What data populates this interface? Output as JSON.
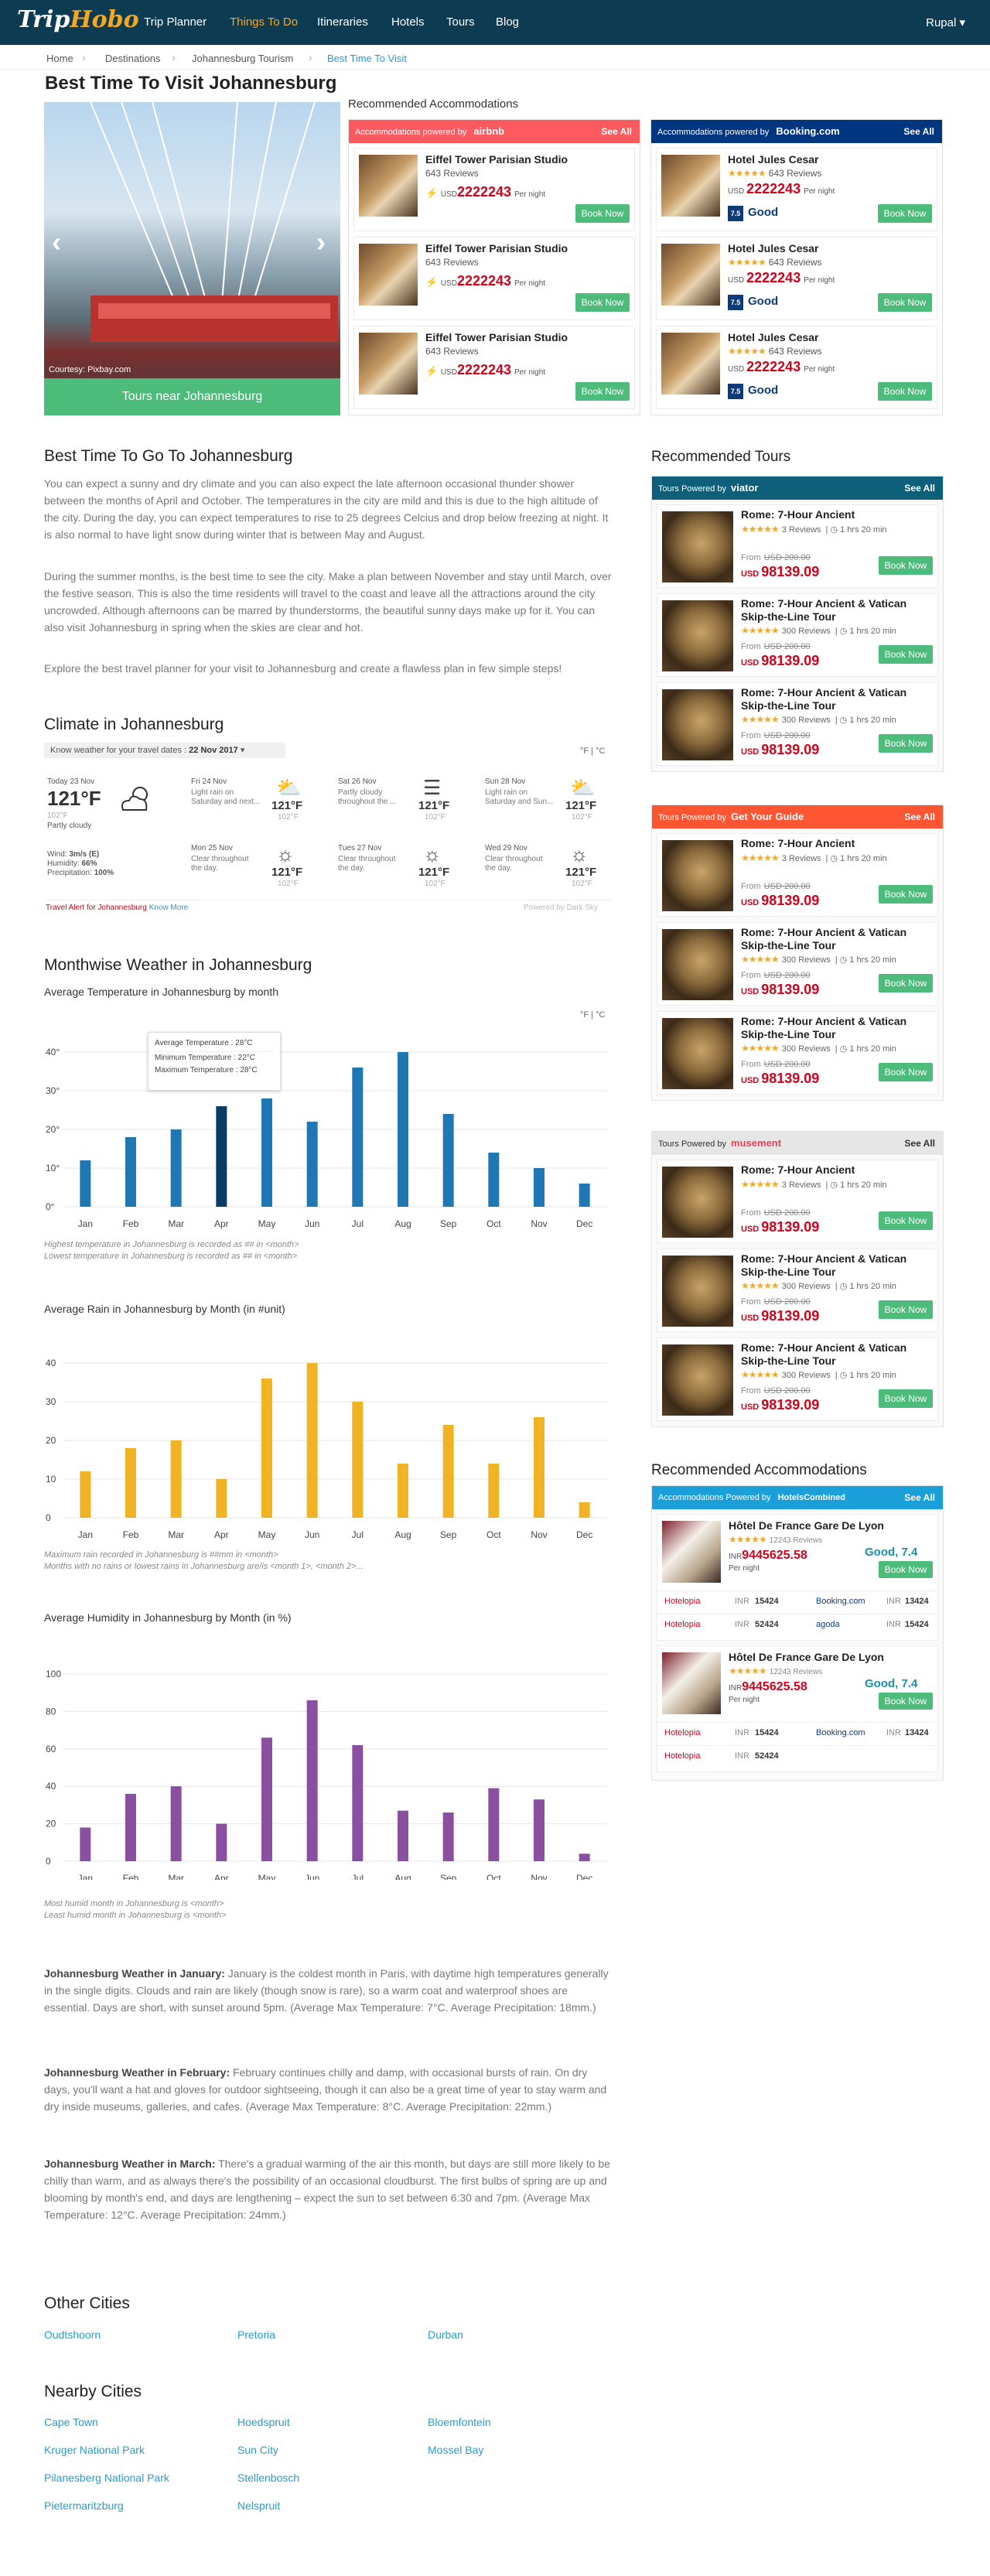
{
  "header": {
    "logo_main": "Trip",
    "logo_accent": "Hobo",
    "nav": [
      "Trip Planner",
      "Things To Do",
      "Itineraries",
      "Hotels",
      "Tours",
      "Blog"
    ],
    "user": "Rupal ▾",
    "colors": {
      "bg": "#0d3b52",
      "active": "#f5a623"
    }
  },
  "breadcrumb": [
    "Home",
    "Destinations",
    "Johannesburg Tourism",
    "Best Time To Visit"
  ],
  "page_title": "Best Time To Visit Johannesburg",
  "slider": {
    "credit": "Courtesy: Pixbay.com",
    "cta": "Tours near Johannesburg",
    "prev_icon": "chevron-left-icon",
    "next_icon": "chevron-right-icon"
  },
  "recommended_accommodations_title": "Recommended Accommodations",
  "airbnb": {
    "head": "Accommodations powered by",
    "brand": "airbnb",
    "see_all": "See All",
    "color": "#ff5a5f",
    "items": [
      {
        "name": "Eiffel Tower Parisian Studio",
        "reviews": "643 Reviews",
        "currency": "USD",
        "price": "2222243",
        "per": "Per night",
        "cta": "Book Now"
      },
      {
        "name": "Eiffel Tower Parisian Studio",
        "reviews": "643 Reviews",
        "currency": "USD",
        "price": "2222243",
        "per": "Per night",
        "cta": "Book Now"
      },
      {
        "name": "Eiffel Tower Parisian Studio",
        "reviews": "643 Reviews",
        "currency": "USD",
        "price": "2222243",
        "per": "Per night",
        "cta": "Book Now"
      }
    ]
  },
  "booking": {
    "head": "Accommodations powered by",
    "brand": "Booking.com",
    "see_all": "See All",
    "color": "#003580",
    "items": [
      {
        "name": "Hotel Jules Cesar",
        "stars": "★★★★★",
        "reviews": "643 Reviews",
        "currency": "USD",
        "price": "2222243",
        "per": "Per night",
        "score": "7.5",
        "score_label": "Good",
        "cta": "Book Now"
      },
      {
        "name": "Hotel Jules Cesar",
        "stars": "★★★★★",
        "reviews": "643 Reviews",
        "currency": "USD",
        "price": "2222243",
        "per": "Per night",
        "score": "7.5",
        "score_label": "Good",
        "cta": "Book Now"
      },
      {
        "name": "Hotel Jules Cesar",
        "stars": "★★★★★",
        "reviews": "643 Reviews",
        "currency": "USD",
        "price": "2222243",
        "per": "Per night",
        "score": "7.5",
        "score_label": "Good",
        "cta": "Book Now"
      }
    ]
  },
  "best_time": {
    "title": "Best Time To Go To Johannesburg",
    "p1": "You can expect a sunny and dry climate and you can also expect the late afternoon occasional thunder shower between the months of April and October. The temperatures in the city are mild and this is due to the high altitude of the city. During the day, you can expect temperatures to rise to 25 degrees Celcius and drop below freezing at night. It is also normal to have light snow during winter that is between May and August.",
    "p2": "During the summer months, is the best time to see the city. Make a plan between November and stay until March, over the festive season. This is also the time residents will travel to the coast and leave all the attractions around the city uncrowded. Although afternoons can be marred by thunderstorms, the beautiful sunny days make up for it. You can also visit Johannesburg in spring when the skies are clear and hot.",
    "p3": "Explore the best travel planner for your visit to Johannesburg and create a flawless plan in few simple steps!"
  },
  "climate": {
    "title": "Climate in Johannesburg",
    "know_label": "Know  weather for your travel dates :",
    "date_value": "22 Nov 2017",
    "units": "°F | °C",
    "today": {
      "day": "Today 23 Nov",
      "temp": "121°F",
      "low": "102°F",
      "desc": "Partly cloudy",
      "wind_label": "Wind:",
      "wind": "3m/s (E)",
      "hum_label": "Humidity:",
      "hum": "66%",
      "prec_label": "Precipitation:",
      "prec": "100%"
    },
    "forecast": [
      {
        "day": "Fri 24 Nov",
        "desc": "Light rain on Saturday and next...",
        "temp": "121°F",
        "low": "102°F",
        "icon": "partly-cloudy-icon"
      },
      {
        "day": "Sat 26 Nov",
        "desc": "Partly cloudy throughout the ...",
        "temp": "121°F",
        "low": "102°F",
        "icon": "fog-icon"
      },
      {
        "day": "Sun 28 Nov",
        "desc": "Light rain on Saturday and Sun...",
        "temp": "121°F",
        "low": "102°F",
        "icon": "partly-cloudy-icon"
      },
      {
        "day": "Mon 25 Nov",
        "desc": "Clear throughout the day.",
        "temp": "121°F",
        "low": "102°F",
        "icon": "sun-icon"
      },
      {
        "day": "Tues 27 Nov",
        "desc": "Clear throughout the day.",
        "temp": "121°F",
        "low": "102°F",
        "icon": "sun-icon"
      },
      {
        "day": "Wed 29 Nov",
        "desc": "Clear throughout the day.",
        "temp": "121°F",
        "low": "102°F",
        "icon": "sun-icon"
      }
    ],
    "alert_label": "Travel Alert for Johannesburg",
    "alert_link": "Know More",
    "powered": "Powered by Dark Sky"
  },
  "monthwise": {
    "title": "Monthwise Weather in Johannesburg",
    "temp_sub": "Average Temperature in Johannesburg by month",
    "temp_units": "°F | °C",
    "temp_note1": "Highest temperature in Johannesburg is recorded as ## in <month>",
    "temp_note2": "Lowest temperature in Johannesburg is recorded as ## in <month>",
    "tooltip": {
      "avg": "Average Temperature : 28°C",
      "min": "Minimum Temperature : 22°C",
      "max": "Maximum Temperature : 28°C"
    },
    "rain_sub": "Average Rain in Johannesburg by Month (in #unit)",
    "rain_note1": "Maximum rain recorded in Johannesburg is ##mm in <month>",
    "rain_note2": "Months with no rains or lowest rains in Johannesburg are/is <month 1>, <month 2>...",
    "hum_sub": "Average Humidity in Johannesburg by Month (in %)",
    "hum_note1": "Most humid month in Johannesburg is <month>",
    "hum_note2": "Least humid month in Johannesburg is <month>"
  },
  "chart_data": [
    {
      "type": "bar",
      "title": "Average Temperature in Johannesburg by month",
      "categories": [
        "Jan",
        "Feb",
        "Mar",
        "Apr",
        "May",
        "Jun",
        "Jul",
        "Aug",
        "Sep",
        "Oct",
        "Nov",
        "Dec"
      ],
      "values": [
        12,
        18,
        20,
        26,
        28,
        22,
        36,
        40,
        24,
        14,
        10,
        6
      ],
      "y_ticks": [
        "0°",
        "10°",
        "20°",
        "30°",
        "40°"
      ],
      "ylim": [
        0,
        40
      ],
      "color": "#1f77b4",
      "highlight_color": "#0b3b63",
      "highlight_index": 3
    },
    {
      "type": "bar",
      "title": "Average Rain in Johannesburg by Month (in #unit)",
      "categories": [
        "Jan",
        "Feb",
        "Mar",
        "Apr",
        "May",
        "Jun",
        "Jul",
        "Aug",
        "Sep",
        "Oct",
        "Nov",
        "Dec"
      ],
      "values": [
        12,
        18,
        20,
        10,
        36,
        40,
        30,
        14,
        24,
        14,
        26,
        4
      ],
      "y_ticks": [
        "0",
        "10",
        "20",
        "30",
        "40"
      ],
      "ylim": [
        0,
        40
      ],
      "color": "#f0b323"
    },
    {
      "type": "bar",
      "title": "Average Humidity in Johannesburg by Month (in %)",
      "categories": [
        "Jan",
        "Feb",
        "Mar",
        "Apr",
        "May",
        "Jun",
        "Jul",
        "Aug",
        "Sep",
        "Oct",
        "Nov",
        "Dec"
      ],
      "values": [
        18,
        36,
        40,
        20,
        66,
        86,
        62,
        27,
        26,
        39,
        33,
        4
      ],
      "y_ticks": [
        "0",
        "20",
        "40",
        "60",
        "80",
        "100"
      ],
      "ylim": [
        0,
        100
      ],
      "color": "#8a4f9e"
    }
  ],
  "month_details": [
    {
      "label": "Johannesburg Weather in January:",
      "text": " January is the coldest month in Paris, with daytime high temperatures generally in the single digits. Clouds and rain are likely (though snow is rare), so a warm coat and waterproof shoes are essential. Days are short, with sunset around 5pm. (Average Max Temperature: 7°C. Average Precipitation: 18mm.)"
    },
    {
      "label": "Johannesburg Weather in February:",
      "text": " February continues chilly and damp, with occasional bursts of rain. On dry days, you'll want a hat and gloves for outdoor sightseeing, though it can also be a great time of year to stay warm and dry inside museums, galleries, and cafes. (Average Max Temperature: 8°C. Average Precipitation: 22mm.)"
    },
    {
      "label": "Johannesburg Weather in March:",
      "text": " There's a gradual warming of the air this month, but days are still more likely to be chilly than warm, and as always there's the possibility of an occasional cloudburst. The first bulbs of spring are up and blooming by month's end, and days are lengthening – expect the sun to set between 6:30 and 7pm. (Average Max Temperature: 12°C. Average Precipitation: 24mm.)"
    }
  ],
  "other_cities": {
    "title": "Other Cities",
    "items": [
      "Oudtshoorn",
      "Pretoria",
      "Durban"
    ]
  },
  "nearby_cities": {
    "title": "Nearby Cities",
    "items": [
      "Cape Town",
      "Hoedspruit",
      "Bloemfontein",
      "Kruger National Park",
      "Sun City",
      "Mossel Bay",
      "Pilanesberg National Park",
      "Stellenbosch",
      "Pietermaritzburg",
      "Nelspruit"
    ]
  },
  "rec_tours": {
    "title": "Recommended Tours",
    "tour_template": [
      {
        "name": "Rome: 7-Hour Ancient",
        "stars": "★★★★★",
        "reviews": "3 Reviews",
        "duration": "1 hrs 20 min",
        "from": "From",
        "old_price": "USD 200.00",
        "currency": "USD",
        "price": "98139.09",
        "cta": "Book Now"
      },
      {
        "name": "Rome: 7-Hour Ancient & Vatican Skip-the-Line Tour",
        "stars": "★★★★★",
        "reviews": "300 Reviews",
        "duration": "1 hrs 20 min",
        "from": "From",
        "old_price": "USD 200.00",
        "currency": "USD",
        "price": "98139.09",
        "cta": "Book Now"
      },
      {
        "name": "Rome: 7-Hour Ancient & Vatican Skip-the-Line Tour",
        "stars": "★★★★★",
        "reviews": "300 Reviews",
        "duration": "1 hrs 20 min",
        "from": "From",
        "old_price": "USD 200.00",
        "currency": "USD",
        "price": "98139.09",
        "cta": "Book Now"
      }
    ],
    "providers": [
      {
        "head": "Tours Powered by",
        "brand": "viator",
        "see_all": "See All",
        "color": "#0d5f7a"
      },
      {
        "head": "Tours Powered by",
        "brand": "Get Your Guide",
        "see_all": "See All",
        "color": "#ff5533"
      },
      {
        "head": "Tours Powered by",
        "brand": "musement",
        "see_all": "See All",
        "color": "#e6e6e6"
      }
    ]
  },
  "hotels_combined": {
    "title": "Recommended Accommodations",
    "head": "Accommodations Powered by",
    "brand": "HotelsCombined",
    "see_all": "See All",
    "color": "#1a9fd9",
    "items": [
      {
        "name": "Hôtel De France Gare De Lyon",
        "stars": "★★★★★",
        "reviews": "12243 Reviews",
        "currency": "INR",
        "price": "9445625.58",
        "per": "Per night",
        "rating": "Good, 7.4",
        "cta": "Book Now",
        "rows": [
          [
            "Hotelopia",
            "INR",
            "15424",
            "Booking.com",
            "INR",
            "13424"
          ],
          [
            "Hotelopia",
            "INR",
            "52424",
            "agoda",
            "INR",
            "15424"
          ]
        ]
      },
      {
        "name": "Hôtel De France Gare De Lyon",
        "stars": "★★★★★",
        "reviews": "12243 Reviews",
        "currency": "INR",
        "price": "9445625.58",
        "per": "Per night",
        "rating": "Good, 7.4",
        "cta": "Book Now",
        "rows": [
          [
            "Hotelopia",
            "INR",
            "15424",
            "Booking.com",
            "INR",
            "13424"
          ],
          [
            "Hotelopia",
            "INR",
            "52424",
            "",
            "",
            ""
          ]
        ]
      }
    ]
  }
}
